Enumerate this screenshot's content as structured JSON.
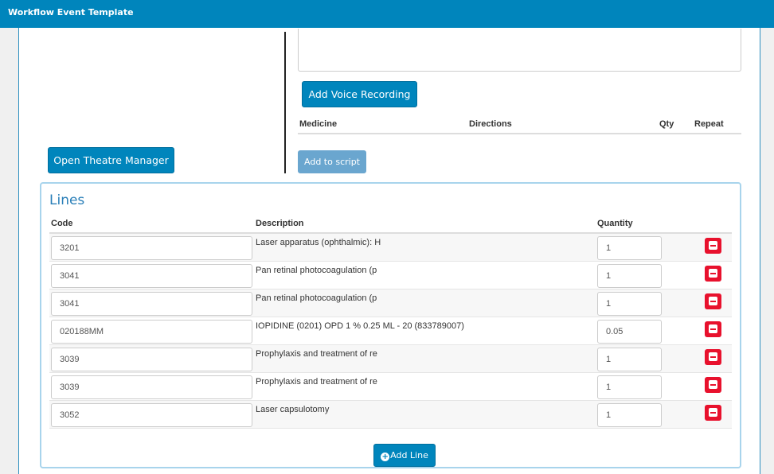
{
  "window": {
    "title": "Workflow Event Template"
  },
  "script": {
    "voice_button": "Add Voice Recording",
    "columns": {
      "medicine": "Medicine",
      "directions": "Directions",
      "qty": "Qty",
      "repeat": "Repeat"
    },
    "add_to_script": "Add to script"
  },
  "theatre": {
    "open_button": "Open Theatre Manager"
  },
  "lines": {
    "title": "Lines",
    "columns": {
      "code": "Code",
      "description": "Description",
      "quantity": "Quantity"
    },
    "rows": [
      {
        "code": "3201",
        "description": "Laser apparatus (ophthalmic): H",
        "quantity": "1"
      },
      {
        "code": "3041",
        "description": "Pan retinal photocoagulation (p",
        "quantity": "1"
      },
      {
        "code": "3041",
        "description": "Pan retinal photocoagulation (p",
        "quantity": "1"
      },
      {
        "code": "020188MM",
        "description": "IOPIDINE (0201) OPD 1 % 0.25 ML - 20 (833789007)",
        "quantity": "0.05"
      },
      {
        "code": "3039",
        "description": "Prophylaxis and treatment of re",
        "quantity": "1"
      },
      {
        "code": "3039",
        "description": "Prophylaxis and treatment of re",
        "quantity": "1"
      },
      {
        "code": "3052",
        "description": "Laser capsulotomy",
        "quantity": "1"
      }
    ],
    "add_line": "Add Line"
  },
  "colors": {
    "header": "#0085bc",
    "remove": "#e8112d",
    "accent": "#2a7fb8"
  }
}
